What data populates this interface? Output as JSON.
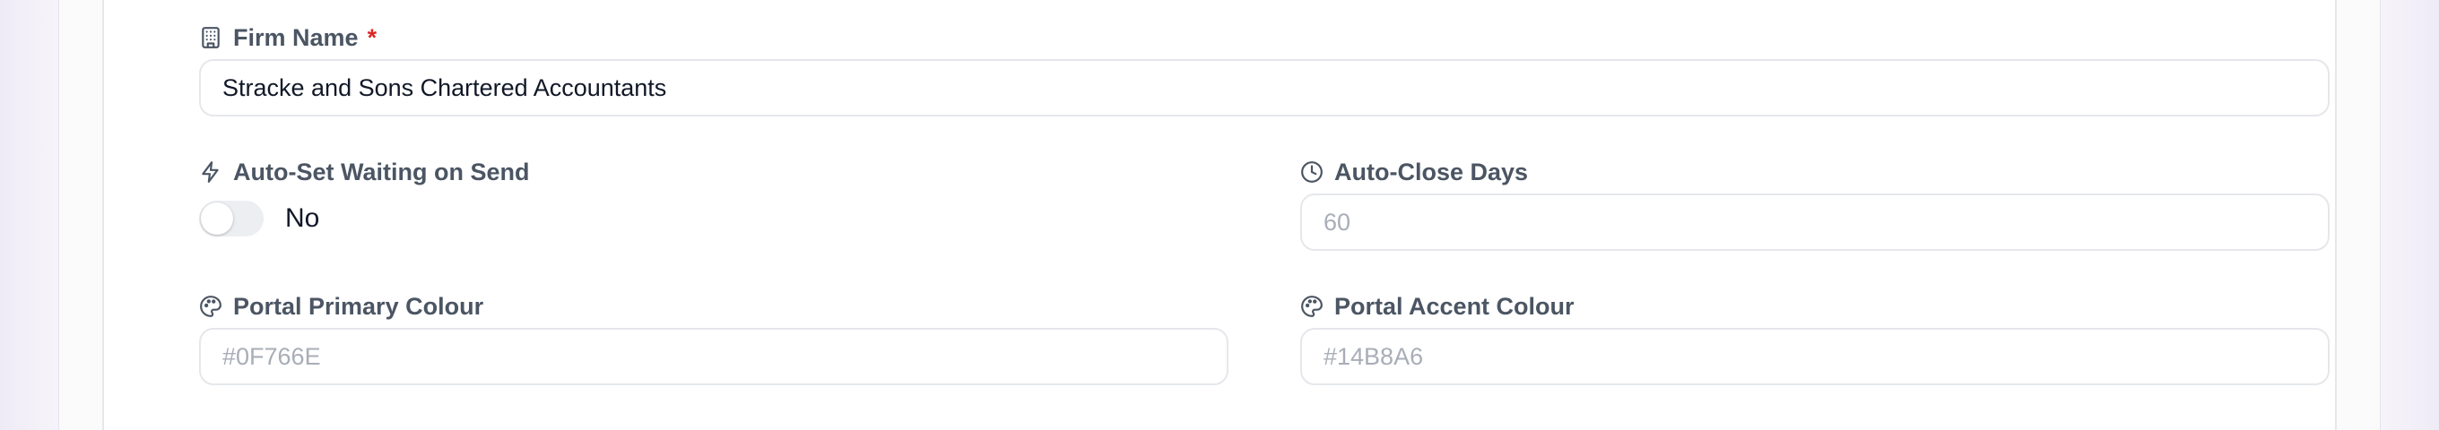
{
  "form": {
    "firm_name": {
      "label": "Firm Name",
      "required_mark": "*",
      "value": "Stracke and Sons Chartered Accountants",
      "icon": "building-icon"
    },
    "auto_set_waiting": {
      "label": "Auto-Set Waiting on Send",
      "toggle_text": "No",
      "enabled": false,
      "icon": "lightning-icon"
    },
    "auto_close_days": {
      "label": "Auto-Close Days",
      "placeholder": "60",
      "icon": "clock-icon"
    },
    "portal_primary_colour": {
      "label": "Portal Primary Colour",
      "placeholder": "#0F766E",
      "icon": "palette-icon"
    },
    "portal_accent_colour": {
      "label": "Portal Accent Colour",
      "placeholder": "#14B8A6",
      "icon": "palette-icon"
    }
  }
}
